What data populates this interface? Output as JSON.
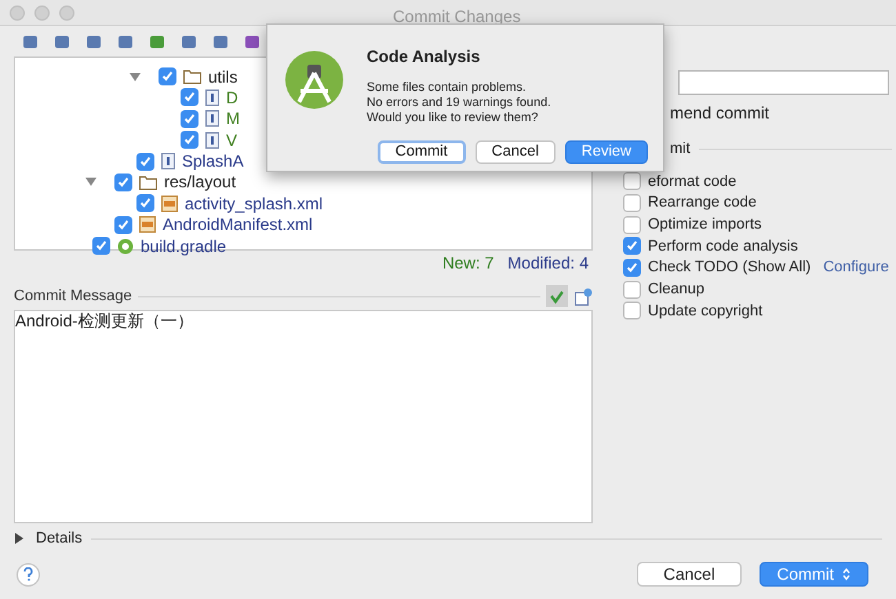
{
  "window": {
    "title": "Commit Changes"
  },
  "tree": [
    {
      "children": [
        {
          "children": [
            {
              "children": [
                {
                  "name": "utils",
                  "kind": "folder",
                  "checked": true,
                  "expanded": true,
                  "children": [
                    {
                      "name": "D",
                      "kind": "java",
                      "color": "#3f7f1f",
                      "checked": true
                    },
                    {
                      "name": "M",
                      "kind": "java",
                      "color": "#3f7f1f",
                      "checked": true
                    },
                    {
                      "name": "V",
                      "kind": "java",
                      "color": "#3f7f1f",
                      "checked": true
                    }
                  ]
                }
              ]
            },
            {
              "name": "SplashA",
              "kind": "java",
              "color": "#2a3a8a",
              "checked": true
            }
          ]
        },
        {
          "name": "res/layout",
          "kind": "folder",
          "checked": true,
          "expanded": true,
          "children": [
            {
              "name": "activity_splash.xml",
              "kind": "xml",
              "color": "#2a3a8a",
              "checked": true
            }
          ]
        },
        {
          "name": "AndroidManifest.xml",
          "kind": "xml",
          "color": "#2a3a8a",
          "checked": true
        }
      ]
    },
    {
      "name": "build.gradle",
      "kind": "gradle",
      "color": "#2a3a8a",
      "checked": true
    }
  ],
  "counts": {
    "new": "New: 7",
    "modified": "Modified: 4"
  },
  "commit_message": {
    "label": "Commit Message",
    "value": "Android-检测更新（一）"
  },
  "details": {
    "label": "Details",
    "expanded": false
  },
  "right": {
    "amend": "mend commit",
    "section": "mit",
    "options": [
      {
        "label": "eformat code",
        "checked": false
      },
      {
        "label": "Rearrange code",
        "checked": false
      },
      {
        "label": "Optimize imports",
        "checked": false
      },
      {
        "label": "Perform code analysis",
        "checked": true
      },
      {
        "label": "Check TODO (Show All)",
        "checked": true,
        "link": "Configure"
      },
      {
        "label": "Cleanup",
        "checked": false
      },
      {
        "label": "Update copyright",
        "checked": false
      }
    ]
  },
  "buttons": {
    "cancel": "Cancel",
    "commit": "Commit"
  },
  "dialog": {
    "title": "Code Analysis",
    "message": "Some files contain problems.\nNo errors and 19 warnings found.\nWould you like to review them?",
    "buttons": [
      {
        "label": "Commit",
        "kind": "focused"
      },
      {
        "label": "Cancel",
        "kind": "plain"
      },
      {
        "label": "Review",
        "kind": "default"
      }
    ]
  }
}
